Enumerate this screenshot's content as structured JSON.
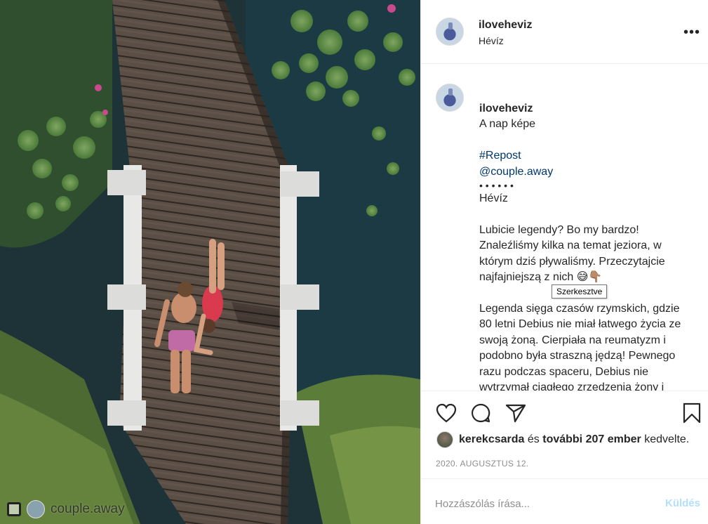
{
  "post": {
    "account": "ilovehevíz",
    "location": "Hévíz"
  },
  "photo": {
    "repost_account": "couple.away"
  },
  "caption": {
    "username": "iloveheviz",
    "headline": "A nap képe",
    "hashtag": "#Repost",
    "mention": "@couple.away",
    "dots": "• • • • • •",
    "place": "Hévíz",
    "paragraph1": "Lubicie legendy? Bo my bardzo! Znaleźliśmy kilka na temat jeziora, w którym dziś pływaliśmy. Przeczytajcie najfajniejszą z nich 😅👇🏽",
    "paragraph2": "Legenda sięga czasów rzymskich, gdzie 80 letni Debius nie miał łatwego życia ze swoją żoną. Cierpiała na reumatyzm i podobno była straszną jędzą! Pewnego razu podczas spaceru, Debius nie wytrzymał ciągłego zrzędzenia żony i wepchnął ją do śmierdzącej jajem wody... a ta nagle poczuła się lepiej, młodziej i piękniej, z"
  },
  "tooltip": "Szerkesztve",
  "likes": {
    "liker": "kerekcsarda",
    "connector": "és",
    "others": "további 207 ember",
    "suffix": "kedvelte."
  },
  "date": "2020. AUGUSZTUS 12.",
  "comment": {
    "placeholder": "Hozzászólás írása...",
    "post_label": "Küldés"
  },
  "colors": {
    "link": "#00376b",
    "border": "#efefef",
    "muted": "#8e8e8e",
    "post_button_disabled": "#b2dffc"
  }
}
